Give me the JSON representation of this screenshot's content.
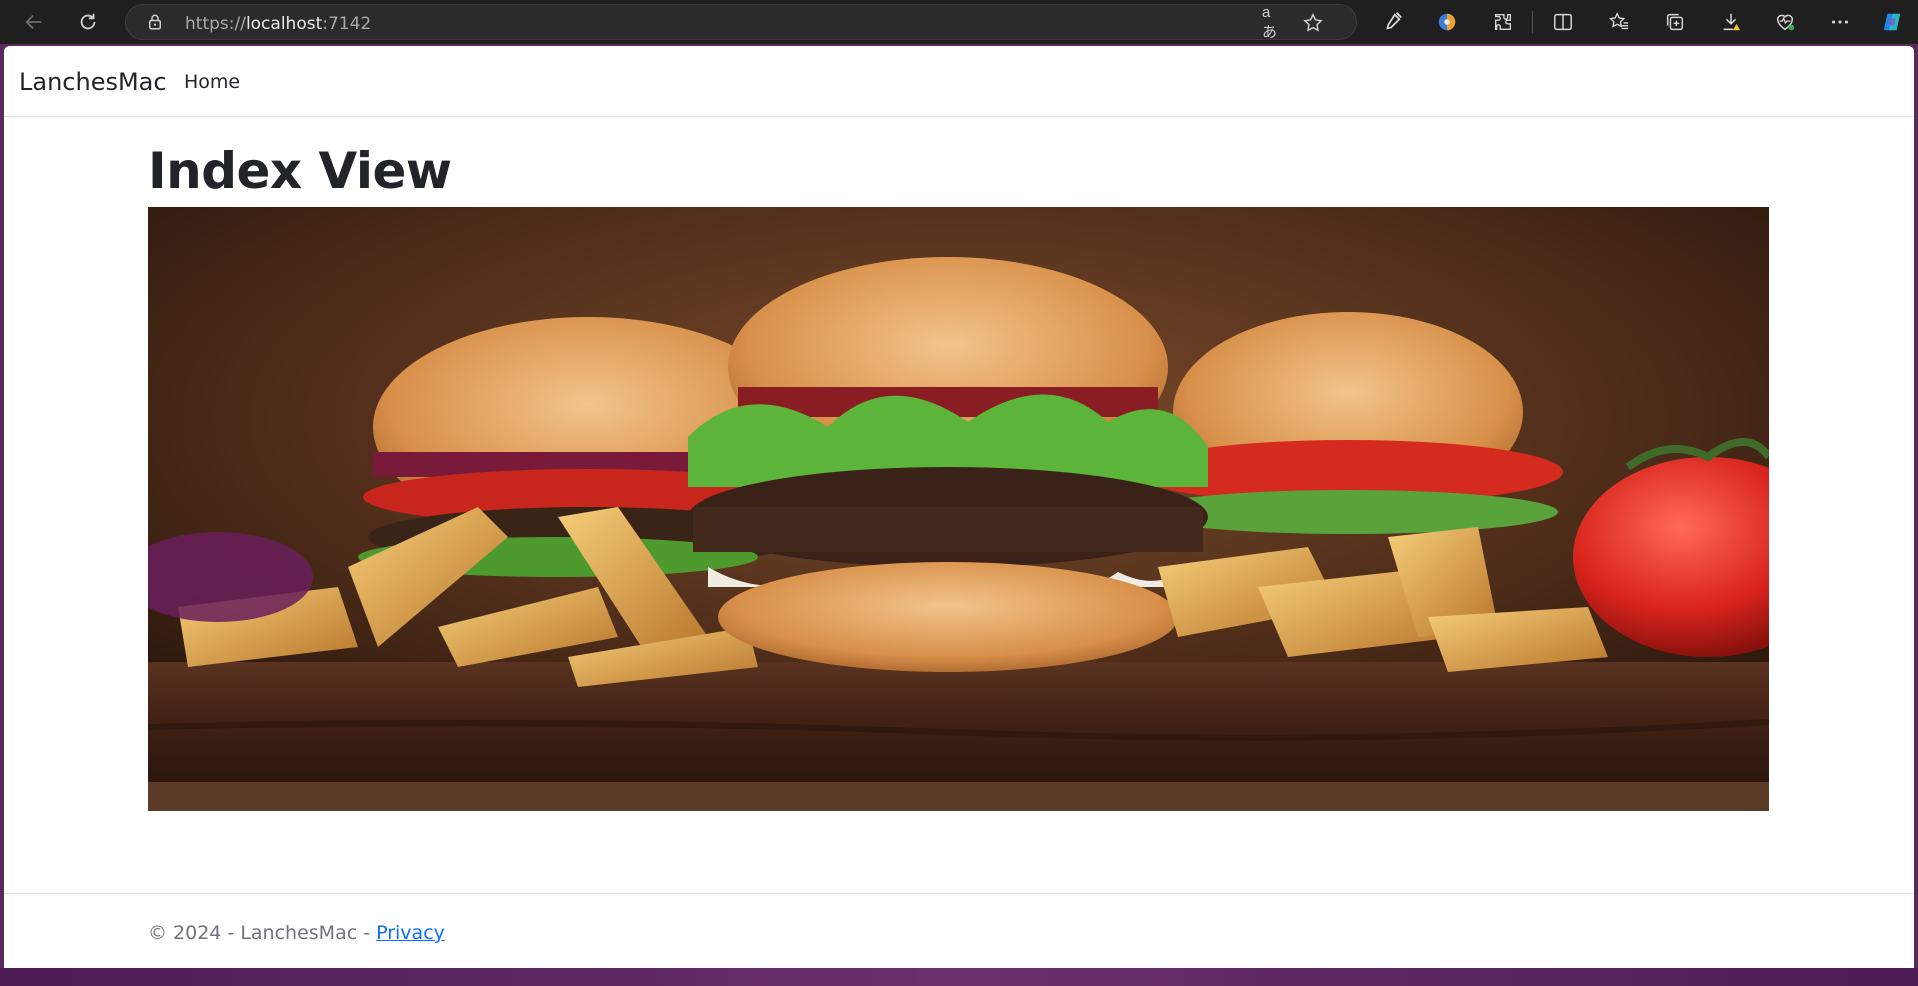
{
  "browser": {
    "url_scheme": "https://",
    "url_host": "localhost",
    "url_port": ":7142",
    "read_aloud_glyph": "aあ"
  },
  "site": {
    "brand": "LanchesMac",
    "nav": [
      {
        "label": "Home"
      }
    ]
  },
  "main": {
    "title": "Index View"
  },
  "footer": {
    "copyright": "© 2024 - LanchesMac - ",
    "privacy_label": "Privacy"
  },
  "colors": {
    "chrome_bg": "#1f1f1f",
    "link": "#0d6efd",
    "text": "#212529",
    "muted": "#6c757d"
  }
}
